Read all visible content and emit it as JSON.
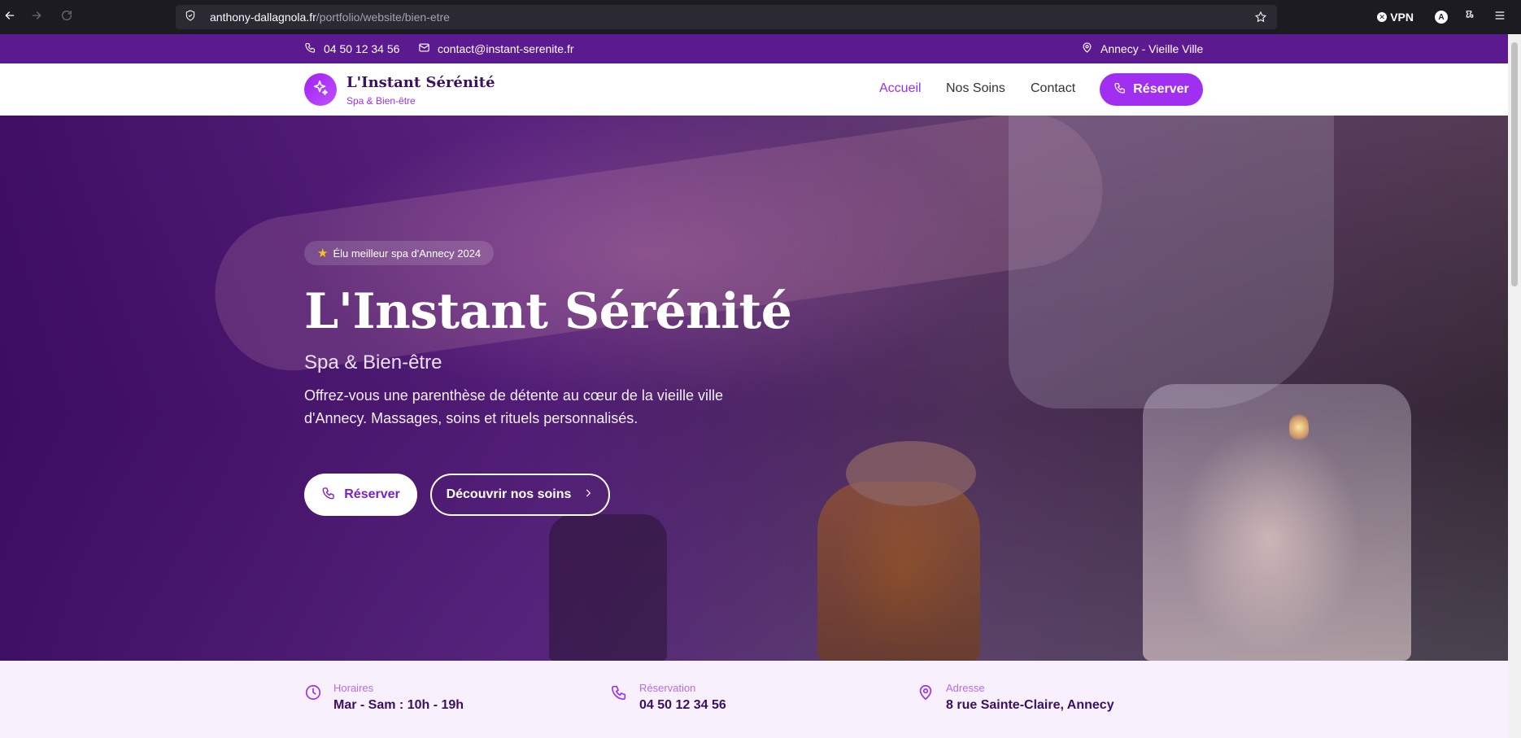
{
  "browser": {
    "url_host": "anthony-dallagnola.fr",
    "url_path": "/portfolio/website/bien-etre",
    "vpn_label": "VPN",
    "account_initial": "A"
  },
  "topbar": {
    "phone": "04 50 12 34 56",
    "email": "contact@instant-serenite.fr",
    "location": "Annecy - Vieille Ville"
  },
  "header": {
    "brand_name": "L'Instant Sérénité",
    "brand_sub": "Spa & Bien-être",
    "nav": [
      "Accueil",
      "Nos Soins",
      "Contact"
    ],
    "active_nav": "Accueil",
    "cta_label": "Réserver"
  },
  "hero": {
    "badge": "Élu meilleur spa d'Annecy 2024",
    "title": "L'Instant Sérénité",
    "subtitle": "Spa & Bien-être",
    "description": "Offrez-vous une parenthèse de détente au cœur de la vieille ville d'Annecy. Massages, soins et rituels personnalisés.",
    "primary_button": "Réserver",
    "secondary_button": "Découvrir nos soins"
  },
  "info": {
    "hours_label": "Horaires",
    "hours_value": "Mar - Sam : 10h - 19h",
    "booking_label": "Réservation",
    "booking_value": "04 50 12 34 56",
    "address_label": "Adresse",
    "address_value": "8 rue Sainte-Claire, Annecy"
  },
  "colors": {
    "topbar_bg": "#5b1a8f",
    "accent": "#a12ff0",
    "brand_dark": "#3a1060",
    "info_bg": "#f8f0fc"
  },
  "icons": [
    "back-icon",
    "forward-icon",
    "reload-icon",
    "shield-icon",
    "star-icon",
    "extensions-icon",
    "menu-icon",
    "phone-icon",
    "mail-icon",
    "map-pin-icon",
    "sparkles-icon",
    "chevron-right-icon",
    "clock-icon"
  ]
}
